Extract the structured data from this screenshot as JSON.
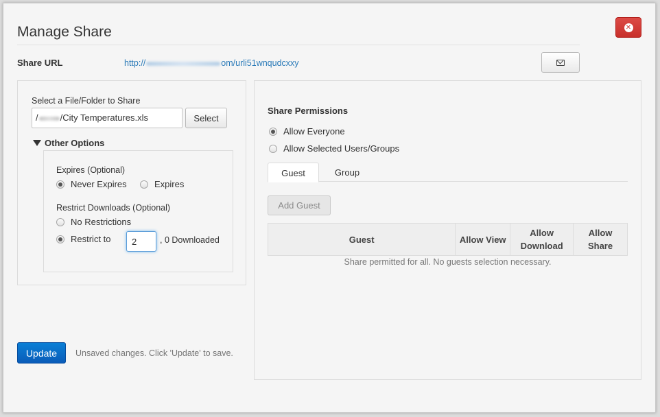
{
  "dialog": {
    "title": "Manage Share",
    "close_icon": "close-circle-icon"
  },
  "share_url": {
    "label": "Share URL",
    "prefix": "http://",
    "suffix": "om/urli51wnqudcxxy",
    "email_icon": "envelope-icon"
  },
  "file_select": {
    "label": "Select a File/Folder to Share",
    "path_prefix": "/",
    "path_suffix": "/City Temperatures.xls",
    "select_label": "Select"
  },
  "other_options": {
    "label": "Other Options",
    "expires": {
      "label": "Expires (Optional)",
      "never_label": "Never Expires",
      "expires_label": "Expires",
      "selected": "Never Expires"
    },
    "restrict": {
      "label": "Restrict Downloads (Optional)",
      "no_restrictions_label": "No Restrictions",
      "restrict_to_label": "Restrict to",
      "restrict_value": "2",
      "downloaded_text": ", 0 Downloaded",
      "selected": "Restrict to"
    }
  },
  "footer": {
    "update_label": "Update",
    "unsaved_text": "Unsaved changes. Click 'Update' to save."
  },
  "permissions": {
    "title": "Share Permissions",
    "allow_everyone_label": "Allow Everyone",
    "allow_selected_label": "Allow Selected Users/Groups",
    "selected": "Allow Everyone",
    "tabs": [
      {
        "label": "Guest",
        "active": true
      },
      {
        "label": "Group",
        "active": false
      }
    ],
    "add_guest_label": "Add Guest",
    "table_headers": [
      "Guest",
      "Allow View",
      "Allow Download",
      "Allow Share"
    ],
    "empty_message": "Share permitted for all. No guests selection necessary."
  },
  "colors": {
    "primary": "#0a6ac8",
    "danger": "#d9413d",
    "link": "#2a7ab8"
  }
}
